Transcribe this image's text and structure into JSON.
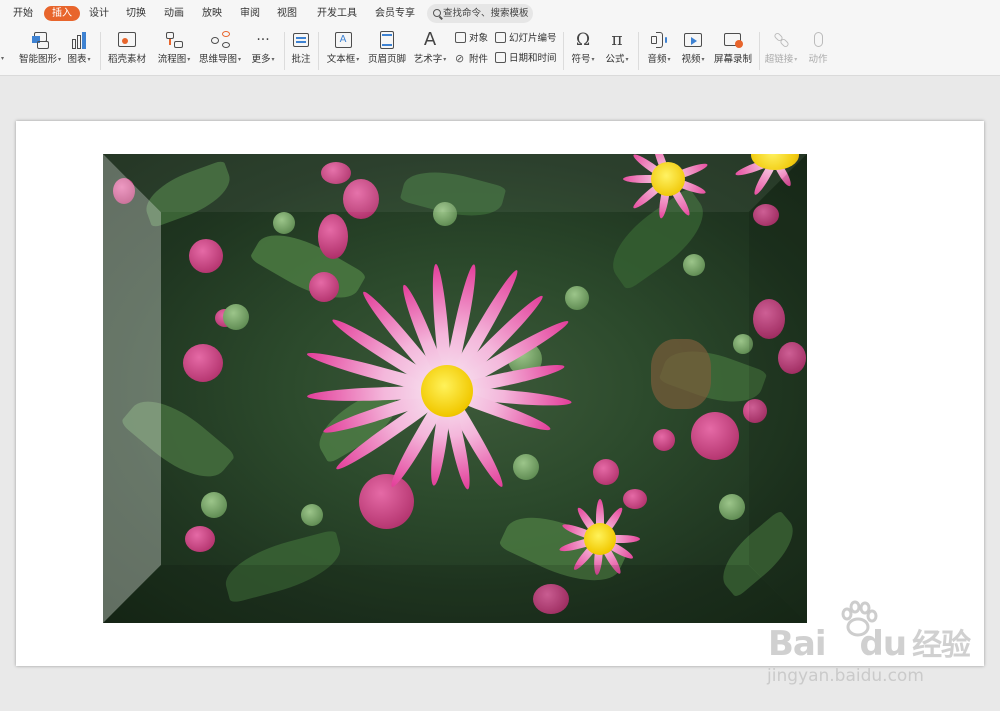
{
  "menu": {
    "tabs": [
      "开始",
      "插入",
      "设计",
      "切换",
      "动画",
      "放映",
      "审阅",
      "视图",
      "开发工具",
      "会员专享"
    ],
    "active_tab": "插入",
    "search_label": "查找命令、搜索模板"
  },
  "ribbon": {
    "smart_art": "智能图形",
    "chart": "图表",
    "docer_material": "稻壳素材",
    "flowchart": "流程图",
    "mindmap": "思维导图",
    "more": "更多",
    "comment": "批注",
    "textbox": "文本框",
    "header_footer": "页眉页脚",
    "wordart": "艺术字",
    "object": "对象",
    "attachment": "附件",
    "slide_number": "幻灯片编号",
    "date_time": "日期和时间",
    "symbol": "符号",
    "formula": "公式",
    "audio": "音频",
    "video": "视频",
    "screen_record": "屏幕录制",
    "hyperlink": "超链接",
    "action": "动作",
    "more_glyph": "···",
    "symbol_glyph": "Ω",
    "formula_glyph": "π"
  },
  "watermark": {
    "logo_text": "Bai",
    "logo_text2": "du",
    "logo_cn": "经验",
    "url": "jingyan.baidu.com"
  },
  "colors": {
    "accent": "#e8652c",
    "icon_blue": "#3e82d2",
    "background": "#e9e9e9",
    "slide": "#ffffff"
  }
}
